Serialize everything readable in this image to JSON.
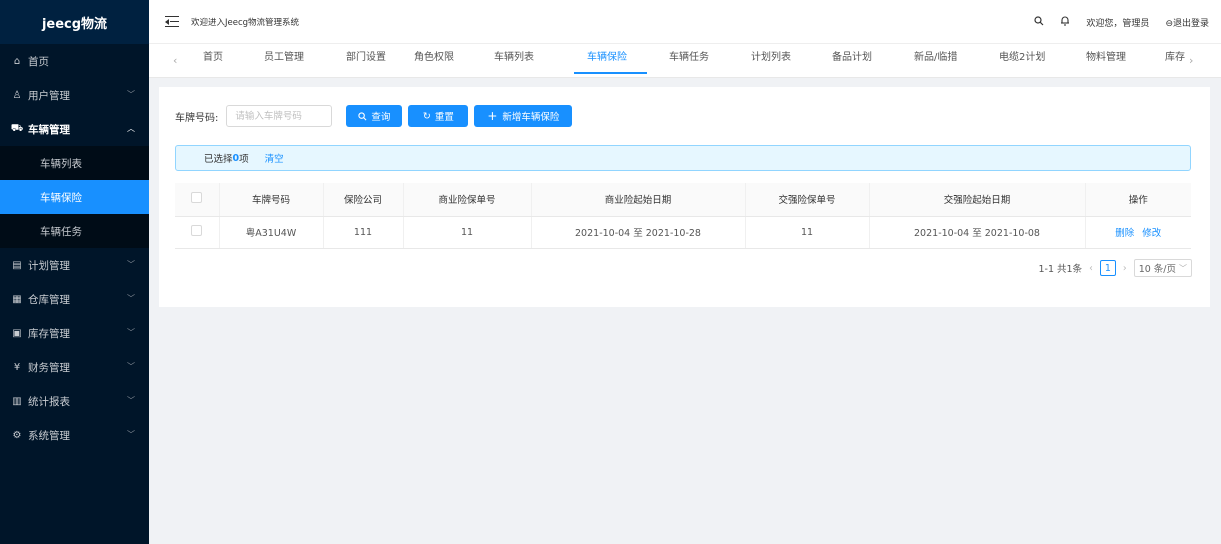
{
  "sidebar": {
    "logo": "jeecg物流",
    "items": [
      {
        "label": "首页",
        "icon": "home-icon",
        "glyph": "⌂",
        "expandable": false
      },
      {
        "label": "用户管理",
        "icon": "user-icon",
        "glyph": "♙",
        "expandable": true
      },
      {
        "label": "车辆管理",
        "icon": "car-icon",
        "glyph": "⛟",
        "expandable": true,
        "open": true,
        "children": [
          {
            "label": "车辆列表"
          },
          {
            "label": "车辆保险",
            "active": true
          },
          {
            "label": "车辆任务"
          }
        ]
      },
      {
        "label": "计划管理",
        "icon": "document-icon",
        "glyph": "▤",
        "expandable": true
      },
      {
        "label": "仓库管理",
        "icon": "grid-icon",
        "glyph": "▦",
        "expandable": true
      },
      {
        "label": "库存管理",
        "icon": "box-icon",
        "glyph": "▣",
        "expandable": true
      },
      {
        "label": "财务管理",
        "icon": "yen-icon",
        "glyph": "¥",
        "expandable": true
      },
      {
        "label": "统计报表",
        "icon": "bar-chart-icon",
        "glyph": "▥",
        "expandable": true
      },
      {
        "label": "系统管理",
        "icon": "gear-icon",
        "glyph": "⚙",
        "expandable": true
      }
    ]
  },
  "header": {
    "welcome": "欢迎进入Jeecg物流管理系统",
    "greeting": "欢迎您，管理员",
    "logout": "退出登录"
  },
  "tabs": {
    "items": [
      "首页",
      "员工管理",
      "部门设置",
      "角色权限",
      "车辆列表",
      "车辆保险",
      "车辆任务",
      "计划列表",
      "备品计划",
      "新品/临措",
      "电缆2计划",
      "物料管理",
      "库存"
    ],
    "active_index": 5
  },
  "search": {
    "label": "车牌号码:",
    "placeholder": "请输入车牌号码",
    "query_button": "查询",
    "reset_button": "重置",
    "add_button": "新增车辆保险"
  },
  "alert": {
    "prefix": "已选择",
    "count": "0",
    "suffix": "项",
    "clear": "清空"
  },
  "table": {
    "columns": [
      "车牌号码",
      "保险公司",
      "商业险保单号",
      "商业险起始日期",
      "交强险保单号",
      "交强险起始日期",
      "操作"
    ],
    "rows": [
      {
        "plate": "粤A31U4W",
        "company": "111",
        "commercial_no": "11",
        "commercial_dates": "2021-10-04 至 2021-10-28",
        "compulsory_no": "11",
        "compulsory_dates": "2021-10-04 至 2021-10-08"
      }
    ],
    "actions": {
      "delete": "删除",
      "edit": "修改"
    }
  },
  "pagination": {
    "total": "1-1 共1条",
    "current_page": "1",
    "page_size": "10 条/页"
  },
  "colors": {
    "primary": "#1890ff",
    "sidebar_bg": "#001529",
    "alert_bg": "#e6f7ff"
  }
}
